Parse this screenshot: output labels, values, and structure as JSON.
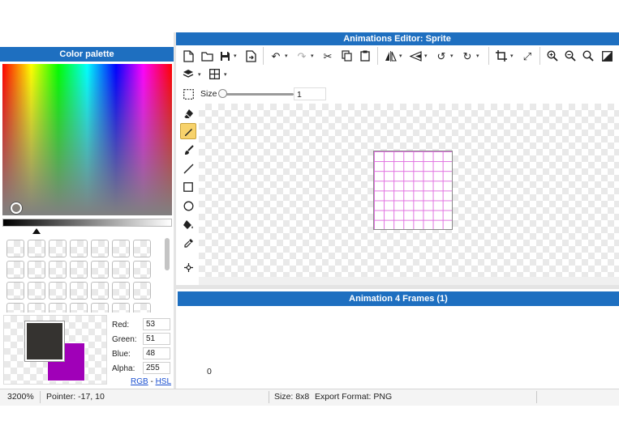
{
  "window": {
    "title": "Animations Editor: Sprite"
  },
  "palette": {
    "title": "Color palette",
    "red_label": "Red:",
    "red_value": "53",
    "green_label": "Green:",
    "green_value": "51",
    "blue_label": "Blue:",
    "blue_value": "48",
    "alpha_label": "Alpha:",
    "alpha_value": "255",
    "mode_rgb": "RGB",
    "mode_sep": "-",
    "mode_hsl": "HSL",
    "primary_color": "#353330",
    "secondary_color": "#a000b8"
  },
  "toolbar": {
    "size_label": "Size",
    "size_value": "1"
  },
  "icons": {
    "new": "new-file-icon",
    "open": "open-folder-icon",
    "save": "save-icon",
    "export": "export-icon",
    "undo": "undo-icon",
    "redo": "redo-icon",
    "cut": "cut-icon",
    "copy": "copy-icon",
    "paste": "paste-icon",
    "flip_h": "flip-horizontal-icon",
    "flip_v": "flip-vertical-icon",
    "rotate_ccw": "rotate-ccw-icon",
    "rotate_cw": "rotate-cw-icon",
    "crop": "crop-icon",
    "resize": "resize-icon",
    "zoom_in": "zoom-in-icon",
    "zoom_out": "zoom-out-icon",
    "zoom_fit": "zoom-fit-icon",
    "contrast": "contrast-icon",
    "layers": "layers-icon",
    "grid": "grid-icon"
  },
  "animation": {
    "title": "Animation 4 Frames (1)",
    "frame_label": "0"
  },
  "status": {
    "zoom": "3200%",
    "pointer": "Pointer: -17, 10",
    "size": "Size: 8x8",
    "format": "Export Format: PNG"
  },
  "colors": {
    "accent": "#1e6fc0",
    "grid_line": "#e070e0",
    "active_tool": "#f7d26b"
  }
}
